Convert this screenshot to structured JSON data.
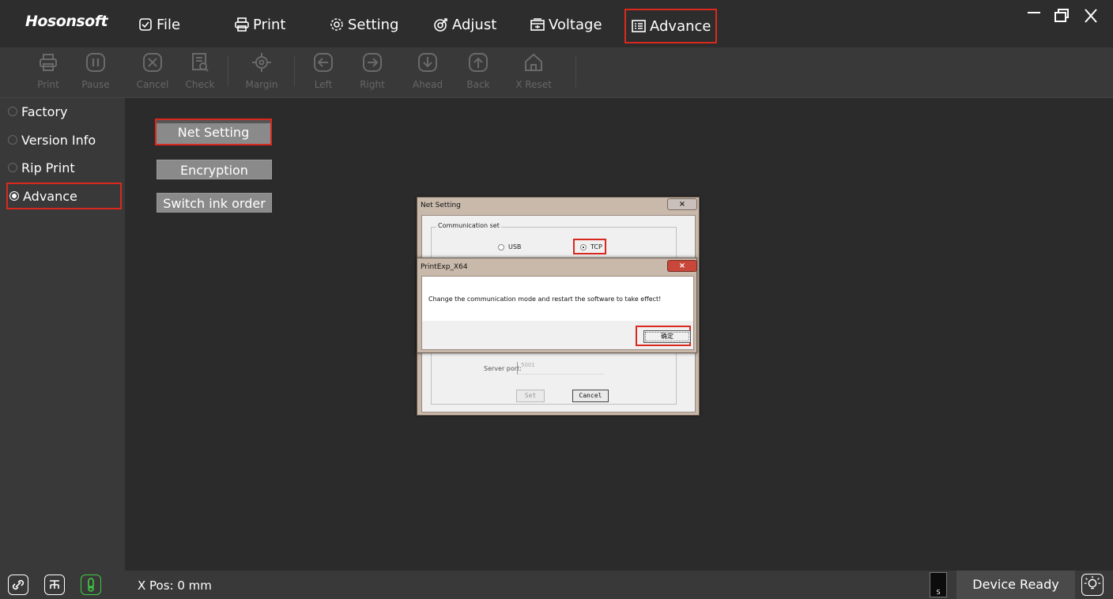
{
  "app": {
    "logo": "Hosonsoft"
  },
  "menubar": {
    "items": [
      {
        "label": "File",
        "icon": "file-check-icon"
      },
      {
        "label": "Print",
        "icon": "printer-icon"
      },
      {
        "label": "Setting",
        "icon": "gear-icon"
      },
      {
        "label": "Adjust",
        "icon": "adjust-icon"
      },
      {
        "label": "Voltage",
        "icon": "voltage-icon"
      },
      {
        "label": "Advance",
        "icon": "list-icon"
      }
    ],
    "window_controls": [
      "minimize-icon",
      "restore-icon",
      "close-icon"
    ]
  },
  "toolbar": {
    "items": [
      {
        "label": "Print",
        "icon": "printer-icon"
      },
      {
        "label": "Pause",
        "icon": "pause-icon"
      },
      {
        "label": "Cancel",
        "icon": "cancel-icon"
      },
      {
        "label": "Check",
        "icon": "check-doc-icon"
      },
      {
        "label": "Margin",
        "icon": "target-icon"
      },
      {
        "label": "Left",
        "icon": "arrow-left-icon"
      },
      {
        "label": "Right",
        "icon": "arrow-right-icon"
      },
      {
        "label": "Ahead",
        "icon": "arrow-down-icon"
      },
      {
        "label": "Back",
        "icon": "arrow-up-icon"
      },
      {
        "label": "X Reset",
        "icon": "home-icon"
      }
    ]
  },
  "sidebar": {
    "items": [
      {
        "label": "Factory",
        "selected": false
      },
      {
        "label": "Version Info",
        "selected": false
      },
      {
        "label": "Rip Print",
        "selected": false
      },
      {
        "label": "Advance",
        "selected": true
      }
    ]
  },
  "main": {
    "buttons": [
      "Net Setting",
      "Encryption",
      "Switch ink order"
    ]
  },
  "net_dialog": {
    "title": "Net Setting",
    "close": "×",
    "group_label": "Communication set",
    "options": [
      {
        "label": "USB",
        "selected": false
      },
      {
        "label": "TCP",
        "selected": true
      }
    ],
    "server_port_label": "Server port:",
    "server_port_value": "5001",
    "set_label": "Set",
    "cancel_label": "Cancel"
  },
  "alert_dialog": {
    "title": "PrintExp_X64",
    "close": "×",
    "message": "Change the communication mode and restart the software to take effect!",
    "ok_label": "确定"
  },
  "statusbar": {
    "xpos": "X Pos: 0 mm",
    "ink_label": "S",
    "status": "Device Ready",
    "temp_color": "#3fcf3f"
  },
  "colors": {
    "highlight": "#d9291f"
  }
}
